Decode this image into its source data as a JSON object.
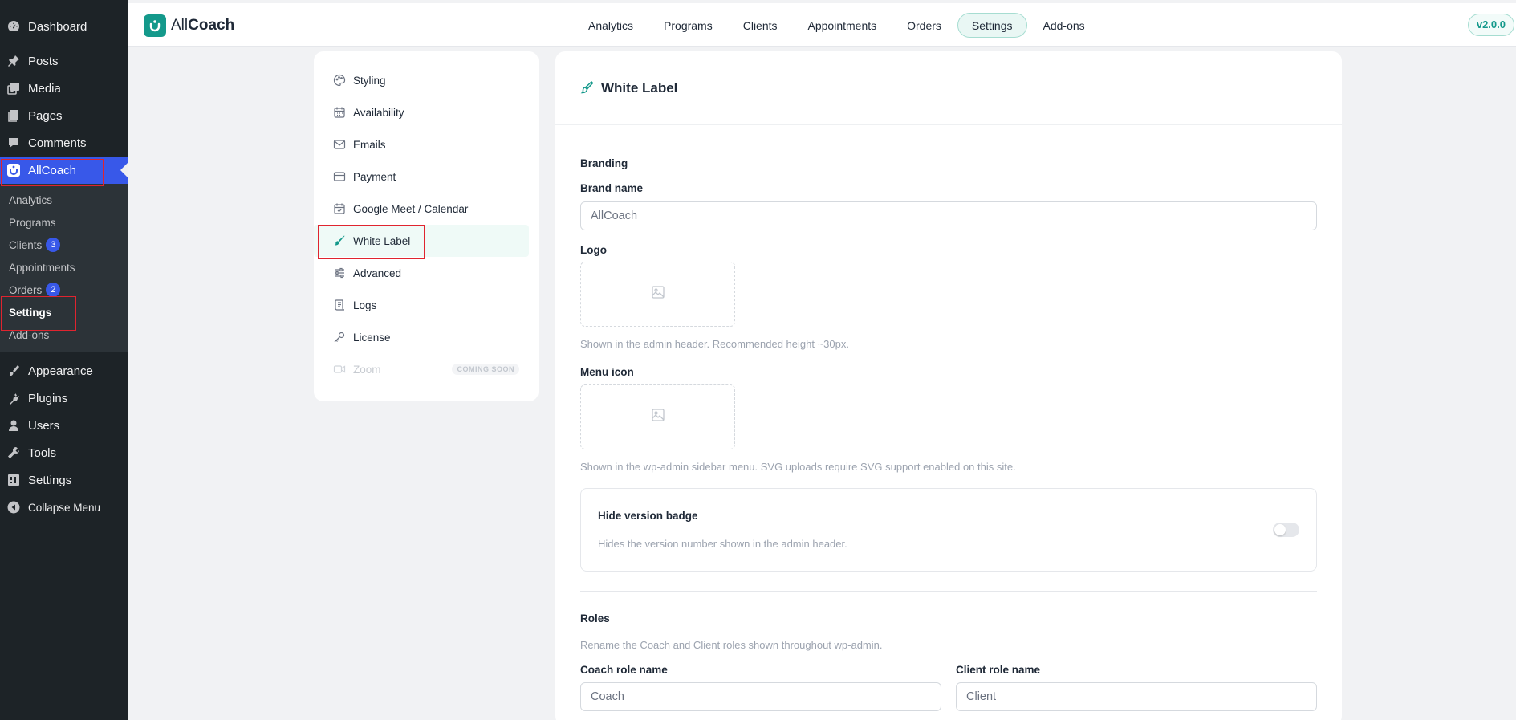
{
  "wp_menu": {
    "top_items": [
      {
        "label": "Dashboard",
        "icon": "dashboard-icon"
      },
      {
        "label": "Posts",
        "icon": "pin-icon"
      },
      {
        "label": "Media",
        "icon": "media-icon"
      },
      {
        "label": "Pages",
        "icon": "pages-icon"
      },
      {
        "label": "Comments",
        "icon": "comment-icon"
      },
      {
        "label": "AllCoach",
        "icon": "allcoach-icon"
      }
    ],
    "submenu": [
      {
        "label": "Analytics"
      },
      {
        "label": "Programs"
      },
      {
        "label": "Clients",
        "count": "3"
      },
      {
        "label": "Appointments"
      },
      {
        "label": "Orders",
        "count": "2"
      },
      {
        "label": "Settings"
      },
      {
        "label": "Add-ons"
      }
    ],
    "bottom_items": [
      {
        "label": "Appearance",
        "icon": "brush-icon"
      },
      {
        "label": "Plugins",
        "icon": "plugin-icon"
      },
      {
        "label": "Users",
        "icon": "user-icon"
      },
      {
        "label": "Tools",
        "icon": "wrench-icon"
      },
      {
        "label": "Settings",
        "icon": "settings-icon"
      },
      {
        "label": "Collapse Menu",
        "icon": "collapse-icon"
      }
    ]
  },
  "header": {
    "brand_light": "All",
    "brand_bold": "Coach",
    "nav": [
      "Analytics",
      "Programs",
      "Clients",
      "Appointments",
      "Orders",
      "Settings",
      "Add-ons"
    ],
    "active_nav": "Settings",
    "version": "v2.0.0"
  },
  "settings_menu": {
    "items": [
      {
        "label": "Styling",
        "icon": "palette-icon"
      },
      {
        "label": "Availability",
        "icon": "calendar-icon"
      },
      {
        "label": "Emails",
        "icon": "mail-icon"
      },
      {
        "label": "Payment",
        "icon": "credit-card-icon"
      },
      {
        "label": "Google Meet / Calendar",
        "icon": "calendar-check-icon"
      },
      {
        "label": "White Label",
        "icon": "paintbrush-icon"
      },
      {
        "label": "Advanced",
        "icon": "sliders-icon"
      },
      {
        "label": "Logs",
        "icon": "scroll-icon"
      },
      {
        "label": "License",
        "icon": "key-icon"
      },
      {
        "label": "Zoom",
        "icon": "video-icon",
        "badge": "COMING SOON"
      }
    ],
    "active": "White Label"
  },
  "content": {
    "title": "White Label",
    "branding": {
      "section_title": "Branding",
      "brand_name_label": "Brand name",
      "brand_name_placeholder": "AllCoach",
      "logo_label": "Logo",
      "logo_help": "Shown in the admin header. Recommended height ~30px.",
      "menu_icon_label": "Menu icon",
      "menu_icon_help": "Shown in the wp-admin sidebar menu. SVG uploads require SVG support enabled on this site."
    },
    "hide_version": {
      "title": "Hide version badge",
      "description": "Hides the version number shown in the admin header.",
      "enabled": false
    },
    "roles": {
      "section_title": "Roles",
      "description": "Rename the Coach and Client roles shown throughout wp-admin.",
      "coach_label": "Coach role name",
      "coach_placeholder": "Coach",
      "client_label": "Client role name",
      "client_placeholder": "Client"
    }
  },
  "colors": {
    "accent": "#14998b",
    "wp_active": "#3858e9",
    "highlight": "#e0242f"
  }
}
